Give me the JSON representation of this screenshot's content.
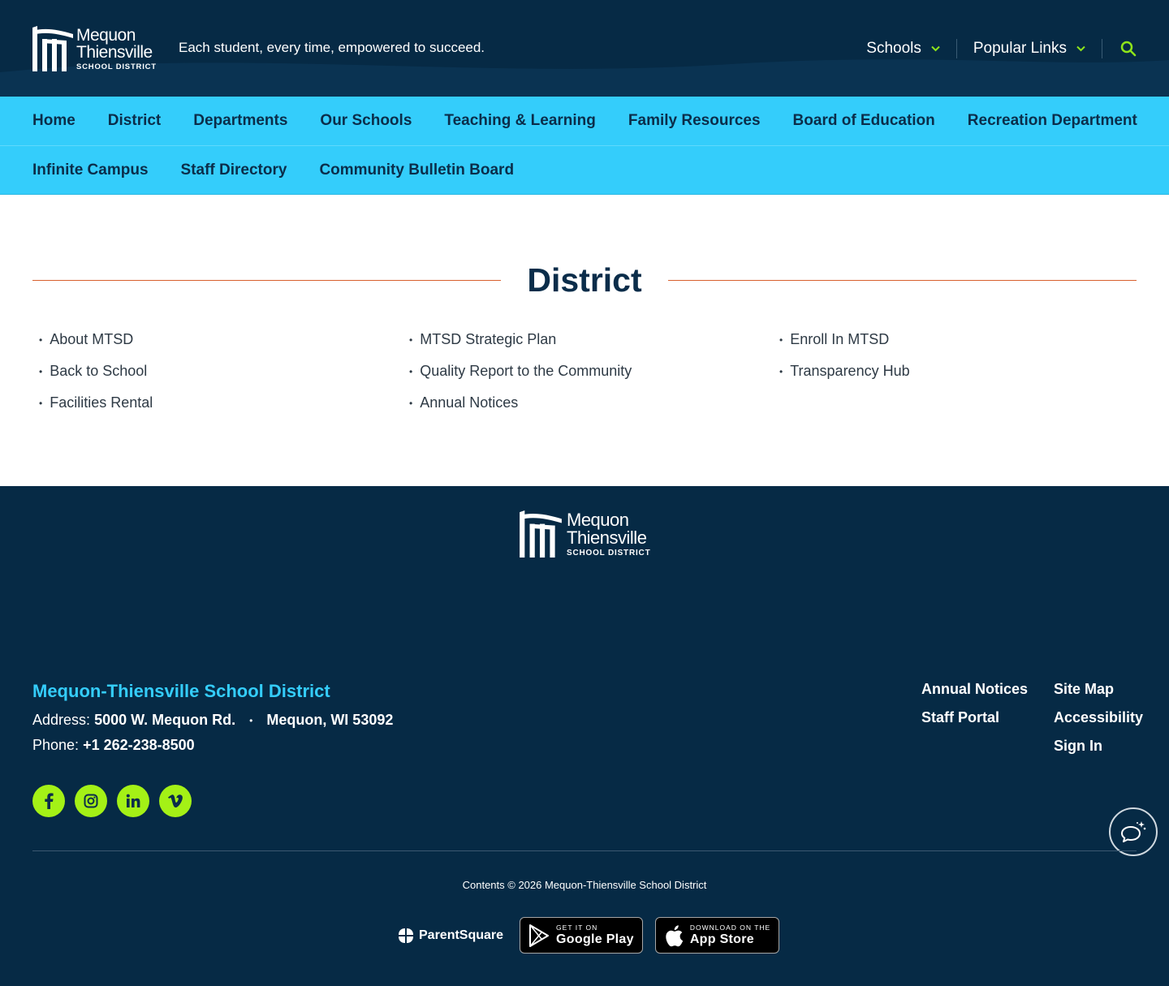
{
  "header": {
    "logo": {
      "line1": "Mequon",
      "line2": "Thiensville",
      "line3": "SCHOOL DISTRICT"
    },
    "tagline": "Each student, every time, empowered to succeed.",
    "utility": {
      "schools": "Schools",
      "popular_links": "Popular Links",
      "search_icon": "search-icon"
    }
  },
  "nav": {
    "row1": [
      "Home",
      "District",
      "Departments",
      "Our Schools",
      "Teaching & Learning",
      "Family Resources",
      "Board of Education",
      "Recreation Department"
    ],
    "row2": [
      "Infinite Campus",
      "Staff Directory",
      "Community Bulletin Board"
    ]
  },
  "page": {
    "title": "District",
    "links": [
      "About MTSD",
      "MTSD Strategic Plan",
      "Enroll In MTSD",
      "Back to School",
      "Quality Report to the Community",
      "Transparency Hub",
      "Facilities Rental",
      "Annual Notices"
    ]
  },
  "footer": {
    "logo": {
      "line1": "Mequon",
      "line2": "Thiensville",
      "line3": "SCHOOL DISTRICT"
    },
    "org_name": "Mequon-Thiensville School District",
    "address_label": "Address:",
    "address_street": "5000 W. Mequon Rd.",
    "address_city": "Mequon, WI 53092",
    "phone_label": "Phone:",
    "phone": "+1 262-238-8500",
    "social": [
      "facebook-icon",
      "instagram-icon",
      "linkedin-icon",
      "vimeo-icon"
    ],
    "links": [
      "Annual Notices",
      "Site Map",
      "Staff Portal",
      "Accessibility",
      "",
      "Sign In"
    ],
    "copyright": "Contents © 2026 Mequon-Thiensville School District",
    "apps": {
      "parentsquare": "ParentSquare",
      "google_small": "GET IT ON",
      "google_big": "Google Play",
      "apple_small": "DOWNLOAD ON THE",
      "apple_big": "App Store"
    }
  },
  "colors": {
    "navy": "#062a45",
    "cyan": "#34cdfb",
    "lime": "#a4f116",
    "rule": "#d8602e"
  }
}
